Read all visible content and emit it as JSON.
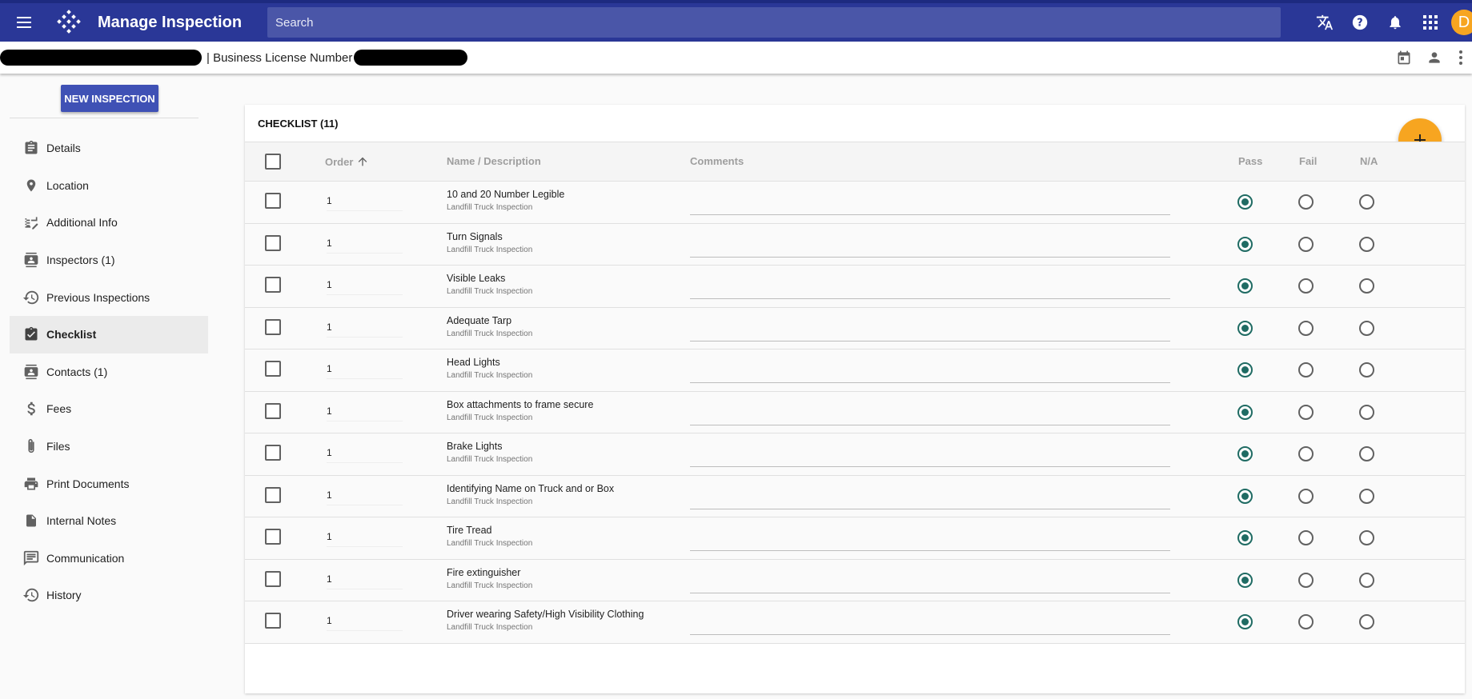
{
  "header": {
    "title": "Manage Inspection",
    "search_placeholder": "Search",
    "avatar_letter": "D",
    "icons": [
      "menu-icon",
      "app-logo",
      "translate-icon",
      "help-icon",
      "notifications-icon",
      "apps-grid-icon"
    ]
  },
  "subheader": {
    "separator_label": "| Business License Number",
    "icons": [
      "calendar-icon",
      "person-icon",
      "more-vertical-icon"
    ]
  },
  "sidebar": {
    "new_button": "NEW INSPECTION",
    "items": [
      {
        "label": "Details",
        "icon": "clipboard-icon"
      },
      {
        "label": "Location",
        "icon": "location-pin-icon"
      },
      {
        "label": "Additional Info",
        "icon": "edit-note-icon"
      },
      {
        "label": "Inspectors (1)",
        "icon": "contact-card-icon"
      },
      {
        "label": "Previous Inspections",
        "icon": "history-icon"
      },
      {
        "label": "Checklist",
        "icon": "checklist-icon",
        "active": true
      },
      {
        "label": "Contacts (1)",
        "icon": "contacts-icon"
      },
      {
        "label": "Fees",
        "icon": "dollar-icon"
      },
      {
        "label": "Files",
        "icon": "attachment-icon"
      },
      {
        "label": "Print Documents",
        "icon": "printer-icon"
      },
      {
        "label": "Internal Notes",
        "icon": "note-icon"
      },
      {
        "label": "Communication",
        "icon": "message-icon"
      },
      {
        "label": "History",
        "icon": "history-icon"
      }
    ]
  },
  "checklist": {
    "title": "CHECKLIST (11)",
    "columns": {
      "order": "Order",
      "name": "Name / Description",
      "comments": "Comments",
      "pass": "Pass",
      "fail": "Fail",
      "na": "N/A"
    },
    "rows": [
      {
        "order": "1",
        "name": "10 and 20 Number Legible",
        "desc": "Landfill Truck Inspection",
        "result": "pass"
      },
      {
        "order": "1",
        "name": "Turn Signals",
        "desc": "Landfill Truck Inspection",
        "result": "pass"
      },
      {
        "order": "1",
        "name": "Visible Leaks",
        "desc": "Landfill Truck Inspection",
        "result": "pass"
      },
      {
        "order": "1",
        "name": "Adequate Tarp",
        "desc": "Landfill Truck Inspection",
        "result": "pass"
      },
      {
        "order": "1",
        "name": "Head Lights",
        "desc": "Landfill Truck Inspection",
        "result": "pass"
      },
      {
        "order": "1",
        "name": "Box attachments to frame secure",
        "desc": "Landfill Truck Inspection",
        "result": "pass"
      },
      {
        "order": "1",
        "name": "Brake Lights",
        "desc": "Landfill Truck Inspection",
        "result": "pass"
      },
      {
        "order": "1",
        "name": "Identifying Name on Truck and or Box",
        "desc": "Landfill Truck Inspection",
        "result": "pass"
      },
      {
        "order": "1",
        "name": "Tire Tread",
        "desc": "Landfill Truck Inspection",
        "result": "pass"
      },
      {
        "order": "1",
        "name": "Fire extinguisher",
        "desc": "Landfill Truck Inspection",
        "result": "pass"
      },
      {
        "order": "1",
        "name": "Driver wearing Safety/High Visibility Clothing",
        "desc": "Landfill Truck Inspection",
        "result": "pass"
      }
    ]
  },
  "colors": {
    "appbar": "#2a3797",
    "accent": "#f7a520",
    "button": "#3f51b5",
    "radio_selected": "#1f6b63"
  }
}
